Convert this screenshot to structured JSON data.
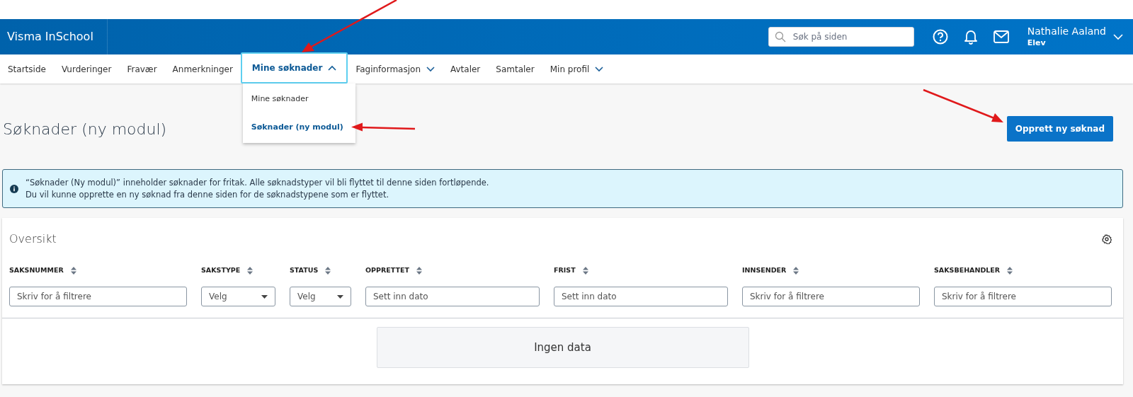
{
  "header": {
    "app_name": "Visma InSchool",
    "search": {
      "placeholder": "Søk på siden"
    },
    "user": {
      "name": "Nathalie Aaland",
      "role": "Elev"
    }
  },
  "nav": {
    "items": [
      {
        "label": "Startside",
        "kind": "link",
        "selected": false
      },
      {
        "label": "Vurderinger",
        "kind": "link",
        "selected": false
      },
      {
        "label": "Fravær",
        "kind": "link",
        "selected": false
      },
      {
        "label": "Anmerkninger",
        "kind": "link",
        "selected": false
      },
      {
        "label": "Mine søknader",
        "kind": "menu",
        "selected": true,
        "expanded": true,
        "menu": [
          {
            "label": "Mine søknader",
            "selected": false
          },
          {
            "label": "Søknader (ny modul)",
            "selected": true
          }
        ]
      },
      {
        "label": "Faginformasjon",
        "kind": "menu",
        "selected": false,
        "expanded": false
      },
      {
        "label": "Avtaler",
        "kind": "link",
        "selected": false
      },
      {
        "label": "Samtaler",
        "kind": "link",
        "selected": false
      },
      {
        "label": "Min profil",
        "kind": "menu",
        "selected": false,
        "expanded": false
      }
    ]
  },
  "page": {
    "title": "Søknader (ny modul)",
    "create_button": "Opprett ny søknad",
    "info": [
      "“Søknader (Ny modul)” inneholder søknader for fritak. Alle søknadstyper vil bli flyttet til denne siden fortløpende.",
      "Du vil kunne opprette en ny søknad fra denne siden for de søknadstypene som er flyttet."
    ]
  },
  "table": {
    "title": "Oversikt",
    "columns": [
      {
        "label": "SAKSNUMMER",
        "kind": "text",
        "placeholder": "Skriv for å filtrere"
      },
      {
        "label": "SAKSTYPE",
        "kind": "select",
        "placeholder": "Velg"
      },
      {
        "label": "STATUS",
        "kind": "select",
        "placeholder": "Velg"
      },
      {
        "label": "OPPRETTET",
        "kind": "date",
        "placeholder": "Sett inn dato"
      },
      {
        "label": "FRIST",
        "kind": "date",
        "placeholder": "Sett inn dato"
      },
      {
        "label": "INNSENDER",
        "kind": "text",
        "placeholder": "Skriv for å filtrere"
      },
      {
        "label": "SAKSBEHANDLER",
        "kind": "text",
        "placeholder": "Skriv for å filtrere"
      }
    ],
    "empty_message": "Ingen data"
  }
}
